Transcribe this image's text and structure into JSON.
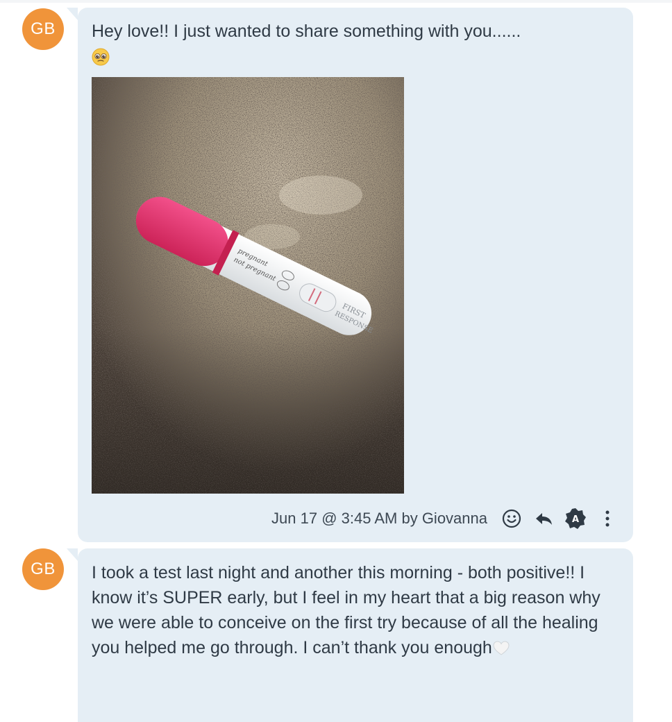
{
  "messages": [
    {
      "avatar_initials": "GB",
      "text": "Hey love!! I just wanted to share something with you......",
      "emoji": "pleading-face-emoji",
      "image_text": {
        "line1": "pregnant",
        "line2": "not pregnant",
        "brand_line1": "FIRST",
        "brand_line2": "RESPONSE"
      },
      "meta": "Jun 17 @ 3:45 AM by Giovanna",
      "actions": {
        "react_icon": "smiley-icon",
        "reply_icon": "reply-arrow-icon",
        "translate_icon": "translate-badge-icon",
        "translate_label": "A",
        "more_icon": "vertical-ellipsis-icon"
      }
    },
    {
      "avatar_initials": "GB",
      "text": "I took a test last night and another this morning - both positive!! I know it’s SUPER early, but I feel in my heart that a big reason why we were able to conceive on the first try because of all the healing you helped me go through. I can’t thank you enough",
      "emoji": "white-heart-emoji"
    }
  ],
  "colors": {
    "avatar": "#f0943a",
    "bubble": "#e5eef5",
    "text": "#2f3a45",
    "test_cap": "#e8336b"
  }
}
